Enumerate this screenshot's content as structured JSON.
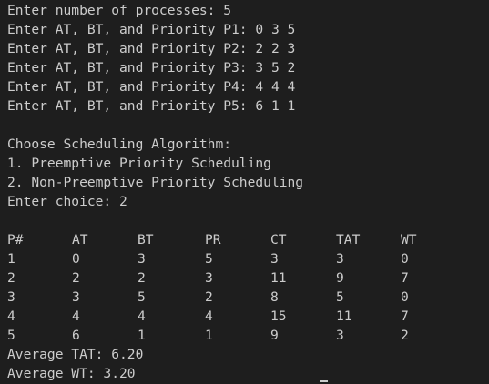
{
  "input_lines": [
    "Enter number of processes: 5",
    "Enter AT, BT, and Priority P1: 0 3 5",
    "Enter AT, BT, and Priority P2: 2 2 3",
    "Enter AT, BT, and Priority P3: 3 5 2",
    "Enter AT, BT, and Priority P4: 4 4 4",
    "Enter AT, BT, and Priority P5: 6 1 1"
  ],
  "menu": {
    "title": "Choose Scheduling Algorithm:",
    "options": [
      "1. Preemptive Priority Scheduling",
      "2. Non-Preemptive Priority Scheduling"
    ],
    "choice_line": "Enter choice: 2"
  },
  "table": {
    "headers": [
      "P#",
      "AT",
      "BT",
      "PR",
      "CT",
      "TAT",
      "WT"
    ],
    "rows": [
      [
        "1",
        "0",
        "3",
        "5",
        "3",
        "3",
        "0"
      ],
      [
        "2",
        "2",
        "2",
        "3",
        "11",
        "9",
        "7"
      ],
      [
        "3",
        "3",
        "5",
        "2",
        "8",
        "5",
        "0"
      ],
      [
        "4",
        "4",
        "4",
        "4",
        "15",
        "11",
        "7"
      ],
      [
        "5",
        "6",
        "1",
        "1",
        "9",
        "3",
        "2"
      ]
    ]
  },
  "summary": {
    "avg_tat": "Average TAT: 6.20",
    "avg_wt": "Average WT: 3.20"
  },
  "colors": {
    "background": "#1e1e1e",
    "text": "#cccccc"
  }
}
